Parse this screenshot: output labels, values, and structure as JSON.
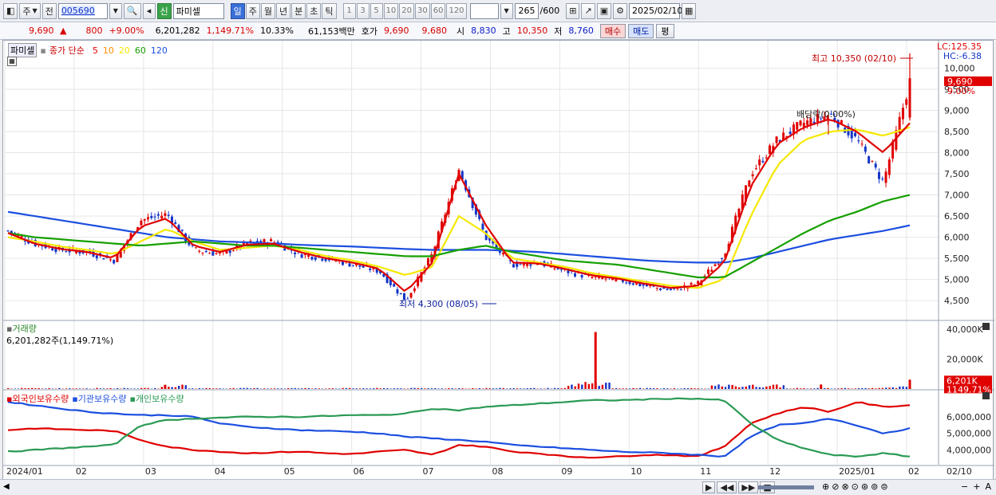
{
  "toolbar": {
    "period_main": "주",
    "jeon_label": "전",
    "stock_code": "005690",
    "badge_new": "신",
    "stock_name": "파미셀",
    "periods": [
      "일",
      "주",
      "월",
      "년",
      "분",
      "초",
      "틱"
    ],
    "active_period": "일",
    "numbers": [
      "1",
      "3",
      "5",
      "10",
      "20",
      "30",
      "60",
      "120"
    ],
    "count_value": "265",
    "count_max": "/600",
    "date_value": "2025/02/10"
  },
  "pricebar": {
    "price": "9,690",
    "change": "800",
    "change_pct": "+9.00%",
    "volume": "6,201,282",
    "volume_pct": "1,149.71%",
    "turnover": "10.33%",
    "amount": "61,153백만",
    "hoga_label": "호가",
    "ask": "9,690",
    "bid": "9,680",
    "open_label": "시",
    "open": "8,830",
    "high_label": "고",
    "high": "10,350",
    "low_label": "저",
    "low": "8,760",
    "buy_label": "매수",
    "sell_label": "매도",
    "eval_label": "평"
  },
  "chart": {
    "tab_label": "파미셀",
    "ma_title": "종가 단순",
    "ma_periods": [
      "5",
      "10",
      "20",
      "60",
      "120"
    ],
    "ma_colors": [
      "#e00000",
      "#ff8c00",
      "#f5e800",
      "#16a000",
      "#1c4fe0"
    ],
    "lc_label": "LC:125.35",
    "hc_label": "HC:-6.38",
    "y_ticks": [
      "10,000",
      "9,500",
      "9,000",
      "8,500",
      "8,000",
      "7,500",
      "7,000",
      "6,500",
      "6,000",
      "5,500",
      "5,000",
      "4,500"
    ],
    "current_price_tag": "9,690",
    "current_pct_tag": "9.00%",
    "high_annot": "최고 10,350 (02/10)",
    "low_annot": "최저 4,300 (08/05)",
    "dividend_annot": "배당락(0.00%)",
    "volume_title": "거래량",
    "volume_info": "6,201,282주(1,149.71%)",
    "volume_ticks": [
      "40,000K",
      "20,000K"
    ],
    "volume_tag": "6,201K",
    "volume_pct_tag": "1149.71%",
    "holdings_titles": [
      "외국인보유수량",
      "기관보유수량",
      "개인보유수량"
    ],
    "holdings_colors": [
      "#e00000",
      "#1c4fe0",
      "#2a9a55"
    ],
    "holdings_ticks": [
      "6,000,000",
      "5,000,000",
      "4,000,000"
    ],
    "x_labels": [
      "2024/01",
      "02",
      "03",
      "04",
      "05",
      "06",
      "07",
      "08",
      "09",
      "10",
      "11",
      "12",
      "2025/01",
      "02"
    ],
    "date_tag": "02/10"
  },
  "chart_data": {
    "type": "candlestick",
    "title": "파미셀",
    "x": [
      "2024/01",
      "02",
      "03",
      "04",
      "05",
      "06",
      "07",
      "08",
      "09",
      "10",
      "11",
      "12",
      "2025/01",
      "02"
    ],
    "close_path": [
      6150,
      5850,
      5700,
      5650,
      5450,
      6400,
      6550,
      5700,
      5600,
      5850,
      5900,
      5600,
      5500,
      5350,
      5200,
      4500,
      5600,
      7600,
      6000,
      5350,
      5400,
      5200,
      5050,
      5000,
      4850,
      4750,
      4900,
      5600,
      7500,
      8300,
      8700,
      8900,
      8300,
      7300,
      9690
    ],
    "ma5_path": [
      6100,
      5850,
      5720,
      5650,
      5500,
      6250,
      6450,
      5800,
      5650,
      5820,
      5850,
      5650,
      5500,
      5400,
      5250,
      4700,
      5400,
      7500,
      6300,
      5400,
      5380,
      5250,
      5100,
      5020,
      4900,
      4800,
      4850,
      5400,
      7200,
      8200,
      8600,
      8800,
      8500,
      8000,
      8700
    ],
    "ma20_path": [
      6000,
      5900,
      5780,
      5700,
      5600,
      5900,
      6200,
      5900,
      5700,
      5750,
      5800,
      5700,
      5550,
      5450,
      5300,
      5100,
      5300,
      6500,
      6100,
      5500,
      5400,
      5300,
      5150,
      5050,
      4950,
      4850,
      4800,
      5000,
      6500,
      7700,
      8300,
      8500,
      8550,
      8400,
      8600
    ],
    "ma60_path": [
      6100,
      6000,
      5950,
      5900,
      5850,
      5800,
      5850,
      5900,
      5850,
      5800,
      5800,
      5750,
      5700,
      5650,
      5600,
      5550,
      5550,
      5700,
      5800,
      5650,
      5550,
      5450,
      5400,
      5350,
      5250,
      5150,
      5050,
      5050,
      5400,
      5750,
      6100,
      6400,
      6600,
      6850,
      7000
    ],
    "ma120_path": [
      6600,
      6500,
      6400,
      6300,
      6200,
      6100,
      6000,
      5950,
      5900,
      5880,
      5850,
      5820,
      5800,
      5780,
      5750,
      5720,
      5700,
      5700,
      5700,
      5680,
      5650,
      5600,
      5550,
      5500,
      5450,
      5420,
      5400,
      5400,
      5500,
      5650,
      5800,
      5950,
      6050,
      6150,
      6280
    ],
    "volume_spikes_k": [
      {
        "date": "03",
        "value": 2800
      },
      {
        "date": "08",
        "value": 38000
      },
      {
        "date": "12",
        "value": 3000
      },
      {
        "date": "02/10",
        "value": 6201
      }
    ],
    "holdings_series": [
      {
        "name": "외국인보유수량",
        "start": 5200000,
        "end": 6700000
      },
      {
        "name": "기관보유수량",
        "start": 6800000,
        "end": 5300000
      },
      {
        "name": "개인보유수량",
        "start": 3900000,
        "end": 3600000
      }
    ]
  },
  "timebar": {
    "right_symbols": [
      "◀",
      "▶",
      "◀◀",
      "▶▶",
      "−",
      "+",
      "A"
    ]
  }
}
